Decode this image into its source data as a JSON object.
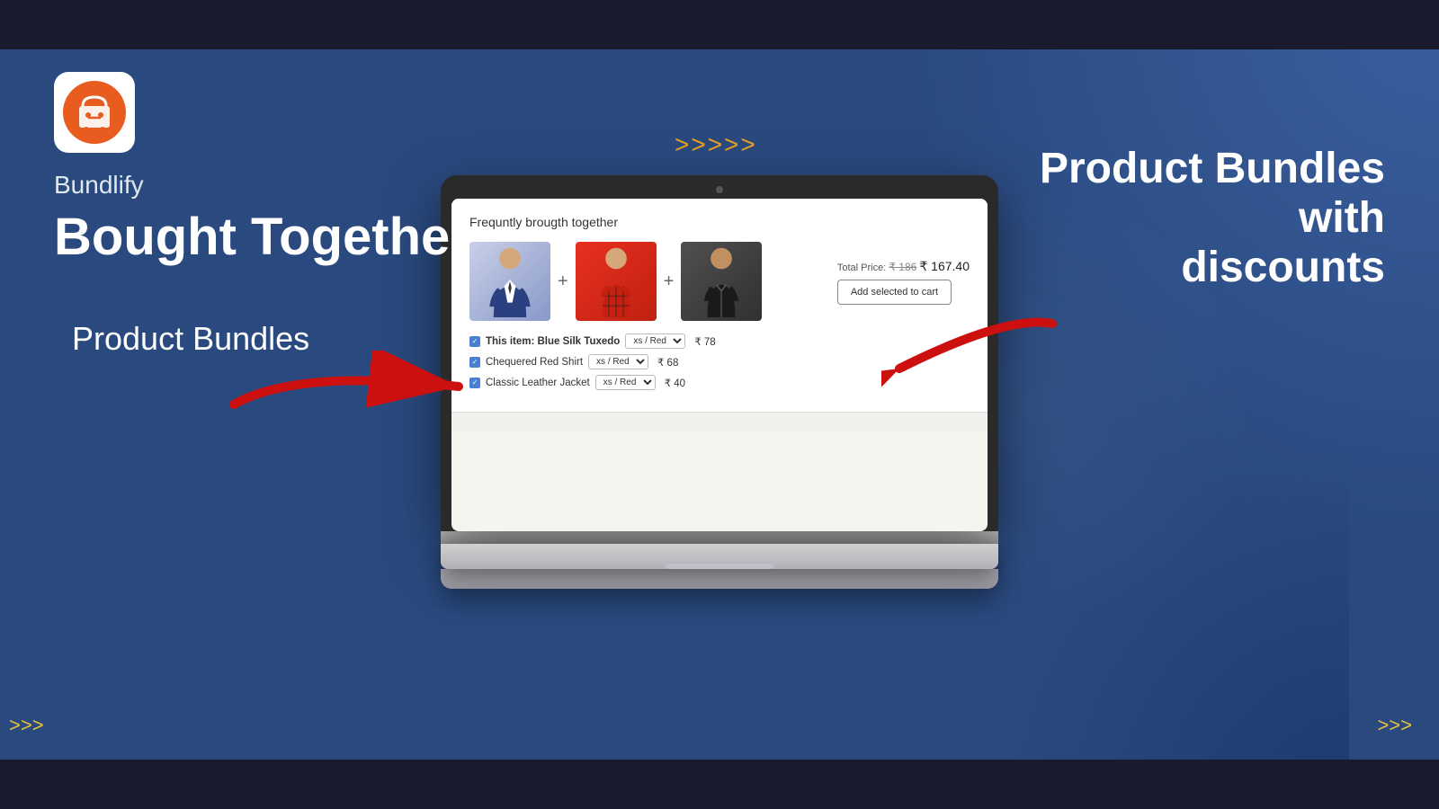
{
  "topBar": {},
  "bottomBar": {},
  "brand": {
    "name": "Bundlify",
    "mainTitle": "Bought Together",
    "productBundlesLabel": "Product Bundles"
  },
  "rightPanel": {
    "title": "Product Bundles with\ndiscounts"
  },
  "chevrons": {
    "center": ">>>>>",
    "bottomRight": ">>>",
    "bottomLeft": ">>>"
  },
  "screen": {
    "title": "Frequntly brougth together",
    "totalPriceLabel": "Total Price:",
    "originalPrice": "₹ 186",
    "discountedPrice": "₹ 167.40",
    "addToCartBtn": "Add selected to cart",
    "products": [
      {
        "name": "This item: Blue Silk Tuxedo",
        "bold": true,
        "size": "xs / Red",
        "price": "₹ 78"
      },
      {
        "name": "Chequered Red Shirt",
        "bold": false,
        "size": "xs / Red",
        "price": "₹ 68"
      },
      {
        "name": "Classic Leather Jacket",
        "bold": false,
        "size": "xs / Red",
        "price": "₹ 40"
      }
    ]
  }
}
